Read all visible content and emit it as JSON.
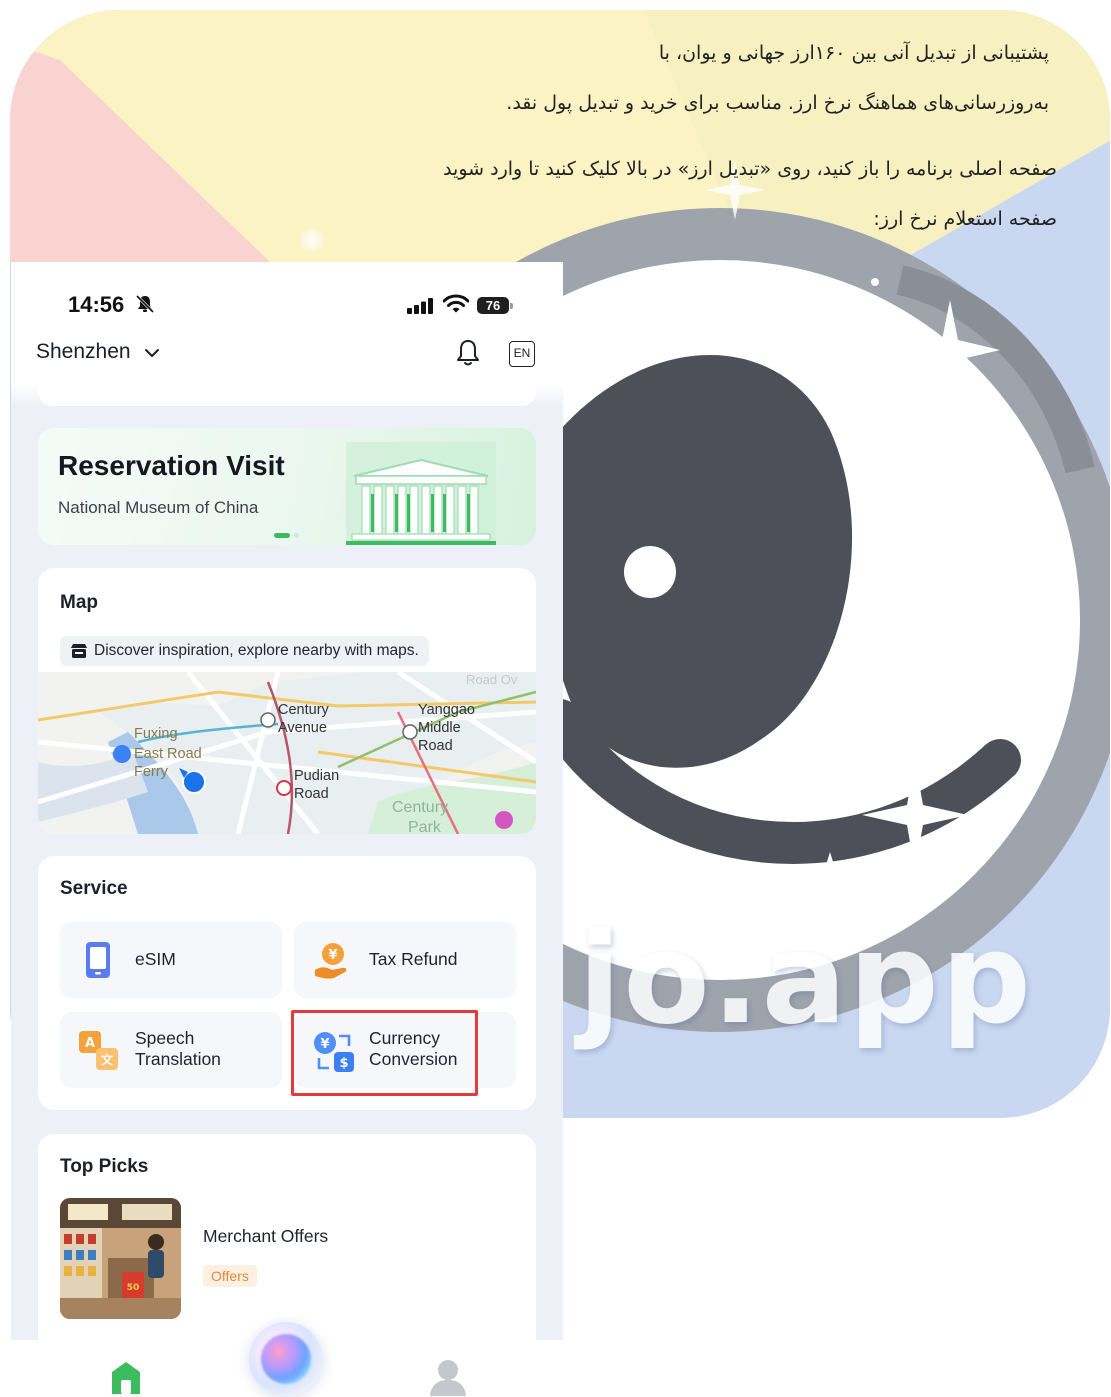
{
  "poster": {
    "line1": "پشتیبانی از تبدیل آنی بین ۱۶۰ارز جهانی و یوان، با",
    "line2": "به‌روزرسانی‌های هماهنگ نرخ ارز. مناسب برای خرید و تبدیل پول نقد.",
    "line3": "صفحه اصلی برنامه را باز کنید، روی «تبدیل ارز» در بالا کلیک کنید تا وارد شوید",
    "line4": "صفحه استعلام نرخ ارز:",
    "watermark": "jo.app"
  },
  "status_bar": {
    "time": "14:56",
    "battery": "76"
  },
  "header": {
    "city": "Shenzhen",
    "language_button": "EN"
  },
  "banner": {
    "title": "Reservation Visit",
    "subtitle": "National Museum of China"
  },
  "map": {
    "title": "Map",
    "tip": "Discover inspiration, explore nearby with maps.",
    "labels": {
      "century_avenue_1": "Century",
      "century_avenue_2": "Avenue",
      "yanggao_1": "Yanggao",
      "yanggao_2": "Middle",
      "yanggao_3": "Road",
      "fuxing_1": "Fuxing",
      "fuxing_2": "East Road",
      "fuxing_3": "Ferry",
      "pudian_1": "Pudian",
      "pudian_2": "Road",
      "century_park_1": "Century",
      "century_park_2": "Park",
      "road_faded": "Road Ov"
    }
  },
  "service": {
    "title": "Service",
    "items": [
      {
        "label": "eSIM",
        "icon": "sim-card-icon"
      },
      {
        "label": "Tax Refund",
        "icon": "tax-refund-icon"
      },
      {
        "label_line1": "Speech",
        "label_line2": "Translation",
        "icon": "translate-icon"
      },
      {
        "label_line1": "Currency",
        "label_line2": "Conversion",
        "icon": "currency-exchange-icon"
      }
    ]
  },
  "top_picks": {
    "title": "Top Picks",
    "item": {
      "title": "Merchant Offers",
      "tag": "Offers"
    }
  },
  "colors": {
    "highlight": "#e23b3b",
    "home_green": "#3dbb5f",
    "offer_tag": "#e08a3c"
  }
}
